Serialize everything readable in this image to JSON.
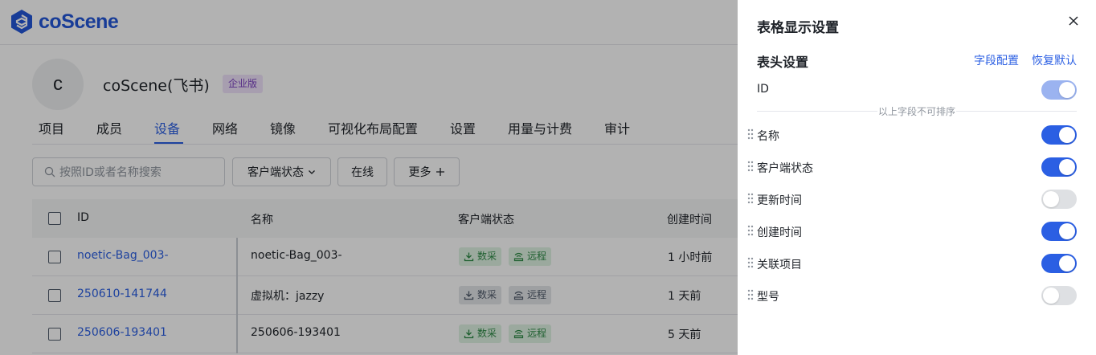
{
  "app": {
    "logo_text": "coScene"
  },
  "org": {
    "avatar_letter": "c",
    "name": "coScene(飞书)",
    "badge": "企业版"
  },
  "tabs": [
    {
      "label": "项目"
    },
    {
      "label": "成员"
    },
    {
      "label": "设备",
      "active": true
    },
    {
      "label": "网络"
    },
    {
      "label": "镜像"
    },
    {
      "label": "可视化布局配置"
    },
    {
      "label": "设置"
    },
    {
      "label": "用量与计费"
    },
    {
      "label": "审计"
    }
  ],
  "filters": {
    "search_placeholder": "按照ID或者名称搜索",
    "client_status": "客户端状态",
    "online": "在线",
    "more": "更多"
  },
  "table": {
    "columns": [
      "ID",
      "名称",
      "客户端状态",
      "创建时间"
    ],
    "rows": [
      {
        "id": "noetic-Bag_003-",
        "name": "noetic-Bag_003-",
        "tag1": "数采",
        "tag2": "远程",
        "status": "online",
        "created": "1 小时前"
      },
      {
        "id": "250610-141744",
        "name": "虚拟机：jazzy",
        "tag1": "数采",
        "tag2": "远程",
        "status": "offline",
        "created": "1 天前"
      },
      {
        "id": "250606-193401",
        "name": "250606-193401",
        "tag1": "数采",
        "tag2": "远程",
        "status": "online",
        "created": "5 天前"
      }
    ]
  },
  "drawer": {
    "title": "表格显示设置",
    "section_title": "表头设置",
    "field_config_link": "字段配置",
    "reset_link": "恢复默认",
    "fixed_field": {
      "label": "ID",
      "enabled": true,
      "disabled": true
    },
    "divider_text": "以上字段不可排序",
    "fields": [
      {
        "label": "名称",
        "enabled": true
      },
      {
        "label": "客户端状态",
        "enabled": true
      },
      {
        "label": "更新时间",
        "enabled": false
      },
      {
        "label": "创建时间",
        "enabled": true
      },
      {
        "label": "关联项目",
        "enabled": true
      },
      {
        "label": "型号",
        "enabled": false
      }
    ]
  },
  "colors": {
    "accent": "#2b5fe3",
    "brand": "#2357d8",
    "tag_green": "#2d8a45"
  }
}
